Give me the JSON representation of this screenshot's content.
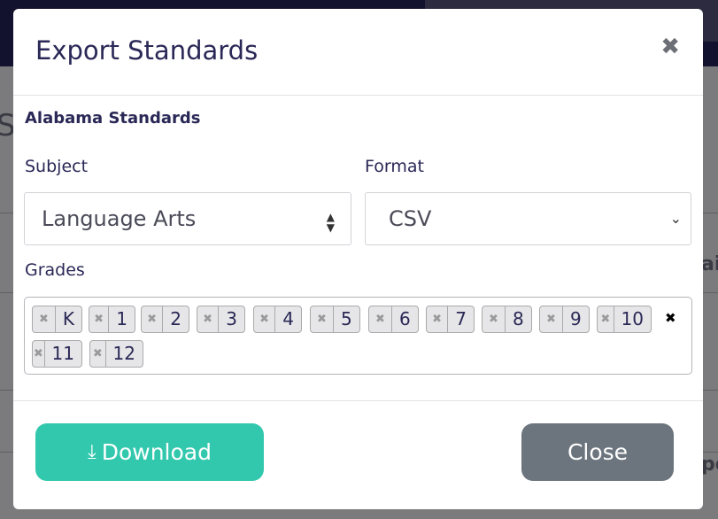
{
  "background": {
    "fragments": [
      "S",
      "ai",
      "pe"
    ]
  },
  "modal": {
    "title": "Export Standards",
    "close_icon": "times-icon",
    "section_title": "Alabama Standards",
    "subject": {
      "label": "Subject",
      "value": "Language Arts"
    },
    "format": {
      "label": "Format",
      "value": "CSV"
    },
    "grades": {
      "label": "Grades",
      "selected": [
        "K",
        "1",
        "2",
        "3",
        "4",
        "5",
        "6",
        "7",
        "8",
        "9",
        "10",
        "11",
        "12"
      ]
    },
    "download_label": "Download",
    "close_label": "Close",
    "colors": {
      "download": "#32c8ad",
      "close": "#6c757d",
      "title": "#2a2856"
    }
  }
}
